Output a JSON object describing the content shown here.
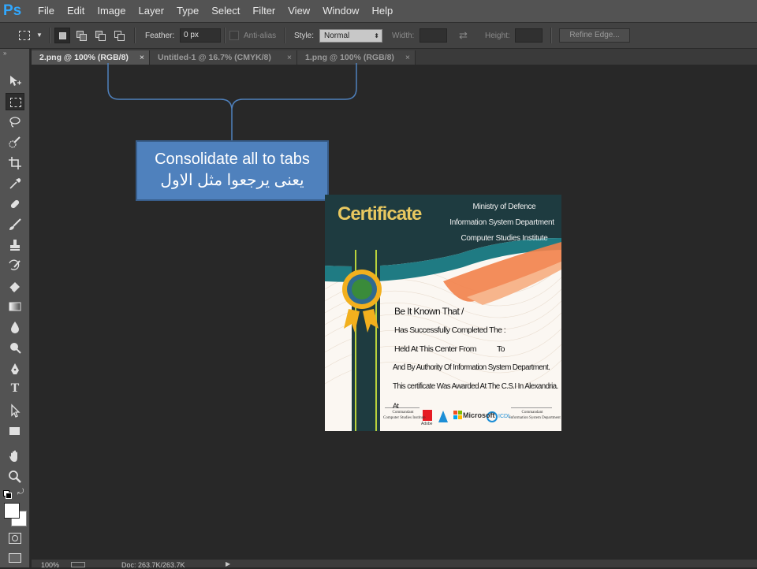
{
  "app": {
    "logo_text": "Ps"
  },
  "menu": [
    "File",
    "Edit",
    "Image",
    "Layer",
    "Type",
    "Select",
    "Filter",
    "View",
    "Window",
    "Help"
  ],
  "options": {
    "feather_label": "Feather:",
    "feather_value": "0 px",
    "antialias_label": "Anti-alias",
    "style_label": "Style:",
    "style_value": "Normal",
    "width_label": "Width:",
    "height_label": "Height:",
    "refine_edge_label": "Refine Edge..."
  },
  "tabs": [
    {
      "label": "2.png @ 100% (RGB/8)",
      "active": true
    },
    {
      "label": "Untitled-1 @ 16.7% (CMYK/8)",
      "active": false
    },
    {
      "label": "1.png @ 100% (RGB/8)",
      "active": false
    }
  ],
  "callout": {
    "line1": "Consolidate all to tabs",
    "line2": "يعنى يرجعوا مثل الاول",
    "fill": "#4f81bd",
    "bracket_color": "#4f81bd"
  },
  "certificate": {
    "title": "Certificate",
    "org_lines": [
      "Ministry of Defence",
      "Information System Department",
      "Computer Studies Institute"
    ],
    "body_lines": [
      "Be It Known That /",
      "Has Successfully Completed The :",
      "Held At This Center From",
      "To",
      "And By Authority Of Information System Department.",
      "This certificate Was Awarded At The C.S.I In Alexandria.",
      "At"
    ],
    "footer_left": [
      "Commandant",
      "Computer Studies Institute"
    ],
    "footer_right": [
      "Commandant",
      "Information System Department"
    ],
    "logos": [
      "Adobe",
      "Microsoft",
      "ICDL"
    ],
    "colors": {
      "header": "#1e3b40",
      "title": "#e8c860",
      "teal": "#1f7b83",
      "orange": "#f2814a"
    }
  },
  "status": {
    "zoom": "100%",
    "doc_info": "Doc: 263.7K/263.7K"
  },
  "icons": {
    "marquee": "rect-marquee-icon",
    "lasso": "lasso-icon",
    "crop": "crop-icon",
    "hand": "hand-icon",
    "zoom": "zoom-icon"
  }
}
